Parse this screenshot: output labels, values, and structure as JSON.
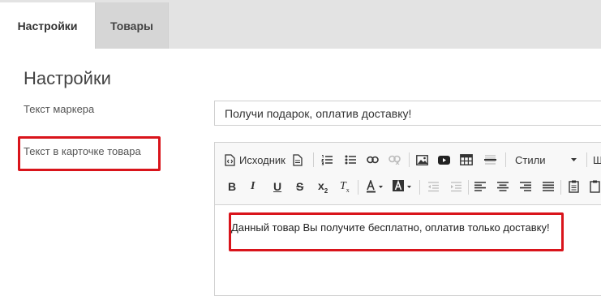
{
  "tabs": [
    {
      "label": "Настройки",
      "active": true
    },
    {
      "label": "Товары",
      "active": false
    }
  ],
  "page_title": "Настройки",
  "fields": {
    "marker_label": "Текст маркера",
    "marker_value": "Получи подарок, оплатив доставку!",
    "card_label": "Текст в карточке товара"
  },
  "editor": {
    "source_label": "Исходник",
    "styles_label": "Стили",
    "format_label_partial": "Ш",
    "content": "Данный товар Вы получите бесплатно, оплатив только доставку!"
  },
  "colors": {
    "highlight": "#d9141b",
    "tabbar_bg": "#e3e3e3"
  }
}
